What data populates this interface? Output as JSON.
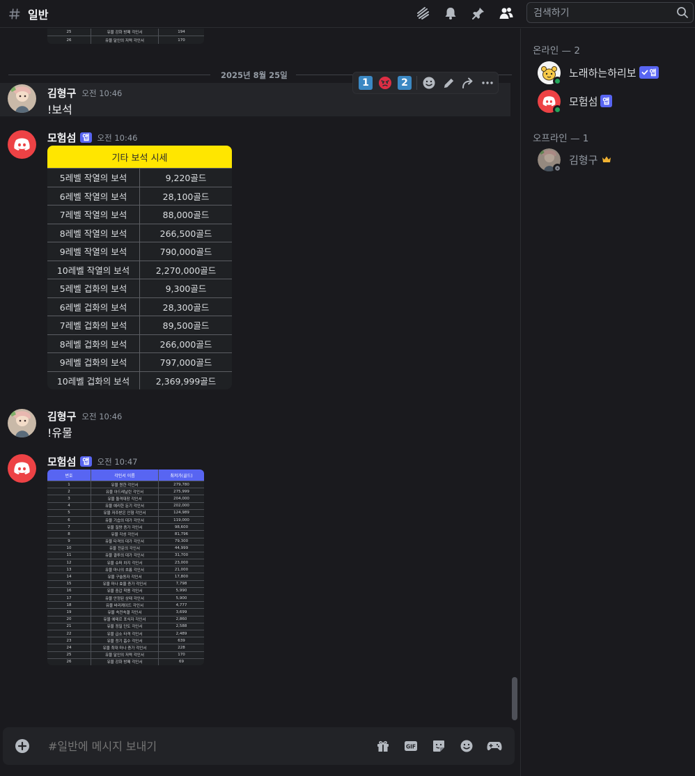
{
  "header": {
    "channel_name": "일반",
    "search_placeholder": "검색하기"
  },
  "chat": {
    "date_divider": "2025년 8월 25일",
    "top_partial_rows": [
      {
        "no": "25",
        "name": "유물 강화 방패 각인서",
        "price": "194"
      },
      {
        "no": "26",
        "name": "유물 달인의 저력 각인서",
        "price": "170"
      }
    ],
    "messages": [
      {
        "author": "김형구",
        "time": "오전 10:46",
        "text": "!보석"
      },
      {
        "author": "모험섬",
        "badge": "앱",
        "time": "오전 10:46"
      },
      {
        "author": "김형구",
        "time": "오전 10:46",
        "text": "!유물"
      },
      {
        "author": "모험섬",
        "badge": "앱",
        "time": "오전 10:47"
      }
    ],
    "gem_table": {
      "title": "기타 보석 시세",
      "rows": [
        {
          "name": "5레벨 작열의 보석",
          "price": "9,220골드"
        },
        {
          "name": "6레벨 작열의 보석",
          "price": "28,100골드"
        },
        {
          "name": "7레벨 작열의 보석",
          "price": "88,000골드"
        },
        {
          "name": "8레벨 작열의 보석",
          "price": "266,500골드"
        },
        {
          "name": "9레벨 작열의 보석",
          "price": "790,000골드"
        },
        {
          "name": "10레벨 작열의 보석",
          "price": "2,270,000골드"
        },
        {
          "name": "5레벨 겁화의 보석",
          "price": "9,300골드"
        },
        {
          "name": "6레벨 겁화의 보석",
          "price": "28,300골드"
        },
        {
          "name": "7레벨 겁화의 보석",
          "price": "89,500골드"
        },
        {
          "name": "8레벨 겁화의 보석",
          "price": "266,000골드"
        },
        {
          "name": "9레벨 겁화의 보석",
          "price": "797,000골드"
        },
        {
          "name": "10레벨 겁화의 보석",
          "price": "2,369,999골드"
        }
      ]
    },
    "relic_table": {
      "headers": [
        "번호",
        "각인서 이름",
        "최저가(골드)"
      ],
      "rows": [
        {
          "no": "1",
          "name": "유물 원한 각인서",
          "price": "279,780"
        },
        {
          "no": "2",
          "name": "유물 아드레날린 각인서",
          "price": "275,999"
        },
        {
          "no": "3",
          "name": "유물 돌격대장 각인서",
          "price": "204,000"
        },
        {
          "no": "4",
          "name": "유물 예리한 둔기 각인서",
          "price": "202,000"
        },
        {
          "no": "5",
          "name": "유물 저주받은 인형 각인서",
          "price": "124,989"
        },
        {
          "no": "6",
          "name": "유물 기습의 대가 각인서",
          "price": "119,000"
        },
        {
          "no": "7",
          "name": "유물 질량 증가 각인서",
          "price": "98,600"
        },
        {
          "no": "8",
          "name": "유물 각성 각인서",
          "price": "81,796"
        },
        {
          "no": "9",
          "name": "유물 타격의 대가 각인서",
          "price": "79,300"
        },
        {
          "no": "10",
          "name": "유물 전문의 각인서",
          "price": "44,999"
        },
        {
          "no": "11",
          "name": "유물 결투의 대가 각인서",
          "price": "31,700"
        },
        {
          "no": "12",
          "name": "유물 슈퍼 차지 각인서",
          "price": "23,000"
        },
        {
          "no": "13",
          "name": "유물 마나의 흐름 각인서",
          "price": "21,000"
        },
        {
          "no": "14",
          "name": "유물 구슬동자 각인서",
          "price": "17,800"
        },
        {
          "no": "15",
          "name": "유물 마나 효율 증가 각인서",
          "price": "7,798"
        },
        {
          "no": "16",
          "name": "유물 중갑 착용 각인서",
          "price": "5,990"
        },
        {
          "no": "17",
          "name": "유물 안정된 상태 각인서",
          "price": "5,900"
        },
        {
          "no": "18",
          "name": "유물 바리케이드 각인서",
          "price": "4,777"
        },
        {
          "no": "19",
          "name": "유물 속전속결 각인서",
          "price": "3,699"
        },
        {
          "no": "20",
          "name": "유물 에테르 포식자 각인서",
          "price": "2,860"
        },
        {
          "no": "21",
          "name": "유물 정밀 단도 각인서",
          "price": "2,588"
        },
        {
          "no": "22",
          "name": "유물 급소 타격 각인서",
          "price": "2,489"
        },
        {
          "no": "23",
          "name": "유물 정기 흡수 각인서",
          "price": "639"
        },
        {
          "no": "24",
          "name": "유물 최대 마나 증가 각인서",
          "price": "228"
        },
        {
          "no": "25",
          "name": "유물 달인의 저력 각인서",
          "price": "170"
        },
        {
          "no": "26",
          "name": "유물 강화 방패 각인서",
          "price": "69"
        }
      ]
    }
  },
  "composer": {
    "placeholder": "#일반에 메시지 보내기"
  },
  "sidebar": {
    "online_title": "온라인 — 2",
    "offline_title": "오프라인 — 1",
    "online": [
      {
        "name": "노래하는하리보",
        "badge": "앱"
      },
      {
        "name": "모험섬",
        "badge": "앱"
      }
    ],
    "offline": [
      {
        "name": "김형구"
      }
    ]
  },
  "colors": {
    "accent": "#5865f2",
    "online": "#23a55a",
    "discord_red": "#ed4245",
    "gem_header": "#ffe600"
  }
}
